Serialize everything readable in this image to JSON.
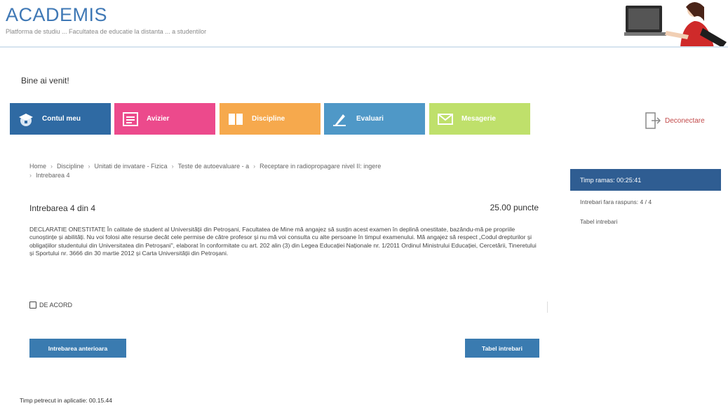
{
  "header": {
    "logo": "ACADEMIS",
    "tagline": "Platforma de studiu ... Facultatea de educatie la distanta ... a studentilor"
  },
  "welcome": "Bine ai venit!",
  "nav": {
    "tiles": [
      {
        "label": "Contul meu",
        "icon": "graduation-cap-icon",
        "color": "#2f6aa3"
      },
      {
        "label": "Avizier",
        "icon": "notice-board-icon",
        "color": "#ec4a8c"
      },
      {
        "label": "Discipline",
        "icon": "book-icon",
        "color": "#f6a94d"
      },
      {
        "label": "Evaluari",
        "icon": "hand-write-icon",
        "color": "#4f98c7"
      },
      {
        "label": "Mesagerie",
        "icon": "envelope-icon",
        "color": "#bfe06b"
      }
    ],
    "logout": "Deconectare"
  },
  "breadcrumb": [
    "Home",
    "Discipline",
    "Unitati de invatare - Fizica",
    "Teste de autoevaluare - a",
    "Receptare in radiopropagare nivel II: ingere",
    "Intrebarea 4"
  ],
  "question": {
    "title": "Intrebarea 4 din 4",
    "points": "25.00 puncte",
    "text": "DECLARATIE ONESTITATE În calitate de student al Universității din Petroșani, Facultatea de Mine mă angajez să susțin acest examen în deplină onestitate, bazându-mă pe propriile cunoștințe și abilități. Nu voi folosi alte resurse decât cele permise de către profesor și nu mă voi consulta cu alte persoane în timpul examenului. Mă angajez să respect „Codul drepturilor și obligațiilor studentului din Universitatea din Petroșani\", elaborat în conformitate cu art. 202 alin (3) din Legea Educației Naționale nr. 1/2011 Ordinul Ministrului Educației, Cercetării, Tineretului și Sportului nr. 3666 din 30 martie 2012 și Carta Universității din Petroșani.",
    "checkbox_label": "DE ACORD",
    "checked": false
  },
  "buttons": {
    "prev": "Intrebarea anterioara",
    "table": "Tabel intrebari"
  },
  "footer": {
    "time_spent": "Timp petrecut in aplicatie: 00.15.44"
  },
  "sidebar": {
    "timer": "Timp ramas: 00:25:41",
    "unanswered": "Intrebari fara raspuns: 4 / 4",
    "table_link": "Tabel intrebari"
  }
}
